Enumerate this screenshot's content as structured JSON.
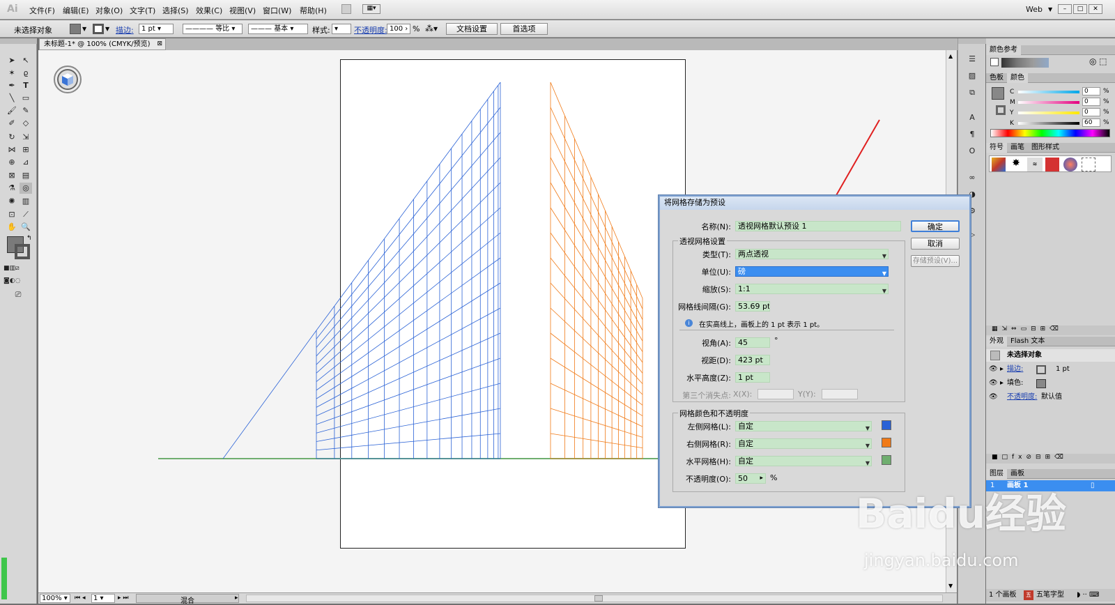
{
  "app": {
    "logo": "Ai",
    "workspace": "Web"
  },
  "menu": [
    "文件(F)",
    "编辑(E)",
    "对象(O)",
    "文字(T)",
    "选择(S)",
    "效果(C)",
    "视图(V)",
    "窗口(W)",
    "帮助(H)"
  ],
  "control_bar": {
    "selection": "未选择对象",
    "stroke_label": "描边:",
    "stroke_value": "1 pt",
    "profile": "等比",
    "brush": "基本",
    "style_label": "样式:",
    "opacity_label": "不透明度:",
    "opacity_value": "100",
    "opacity_unit": "%",
    "doc_setup": "文档设置",
    "preferences": "首选项"
  },
  "document": {
    "tab_title": "未标题-1* @ 100% (CMYK/预览)"
  },
  "status": {
    "zoom": "100%",
    "page": "1",
    "mode": "混合"
  },
  "panels": {
    "color_guide": "颜色参考",
    "swatches_tabs": [
      "色板",
      "颜色"
    ],
    "cmyk": [
      {
        "ch": "C",
        "val": "0"
      },
      {
        "ch": "M",
        "val": "0"
      },
      {
        "ch": "Y",
        "val": "0"
      },
      {
        "ch": "K",
        "val": "60"
      }
    ],
    "percent": "%",
    "symbols_tabs": [
      "符号",
      "画笔",
      "图形样式"
    ],
    "appearance_tabs": [
      "外观",
      "Flash 文本"
    ],
    "appearance_title": "未选择对象",
    "appearance_rows": [
      {
        "label": "描边:",
        "value": "1 pt"
      },
      {
        "label": "填色:",
        "value": ""
      },
      {
        "label": "不透明度:",
        "value": "默认值"
      }
    ],
    "layers_tabs": [
      "图层",
      "画板"
    ],
    "layer_row": {
      "index": "1",
      "name": "画板 1"
    },
    "footer": {
      "artboards": "1 个画板",
      "ime": "五笔字型"
    }
  },
  "dialog": {
    "title": "将网格存储为预设",
    "name_label": "名称(N):",
    "name_value": "透视网格默认预设 1",
    "ok": "确定",
    "cancel": "取消",
    "save_preset": "存储预设(V)...",
    "grid_settings_title": "透视网格设置",
    "type_label": "类型(T):",
    "type_value": "两点透视",
    "unit_label": "单位(U):",
    "unit_value": "磅",
    "scale_label": "缩放(S):",
    "scale_value": "1:1",
    "gridline_label": "网格线间隔(G):",
    "gridline_value": "53.69 pt",
    "info_text": "在实高线上，画板上的 1 pt 表示 1 pt。",
    "angle_label": "视角(A):",
    "angle_value": "45",
    "angle_unit": "°",
    "distance_label": "视距(D):",
    "distance_value": "423 pt",
    "horizon_label": "水平高度(Z):",
    "horizon_value": "1 pt",
    "third_vp_label": "第三个消失点:",
    "x_label": "X(X):",
    "y_label": "Y(Y):",
    "color_group_title": "网格颜色和不透明度",
    "left_grid_label": "左侧网格(L):",
    "left_grid_value": "自定",
    "right_grid_label": "右侧网格(R):",
    "right_grid_value": "自定",
    "horiz_grid_label": "水平网格(H):",
    "horiz_grid_value": "自定",
    "opacity_label": "不透明度(O):",
    "opacity_value": "50",
    "opacity_unit": "%"
  },
  "colors": {
    "left_grid": "#2a62d6",
    "right_grid": "#f07a17",
    "horizontal_grid": "#6fae6f",
    "selection": "#3b8ef0"
  },
  "watermark": {
    "main": "Baidu经验",
    "sub": "jingyan.baidu.com"
  }
}
